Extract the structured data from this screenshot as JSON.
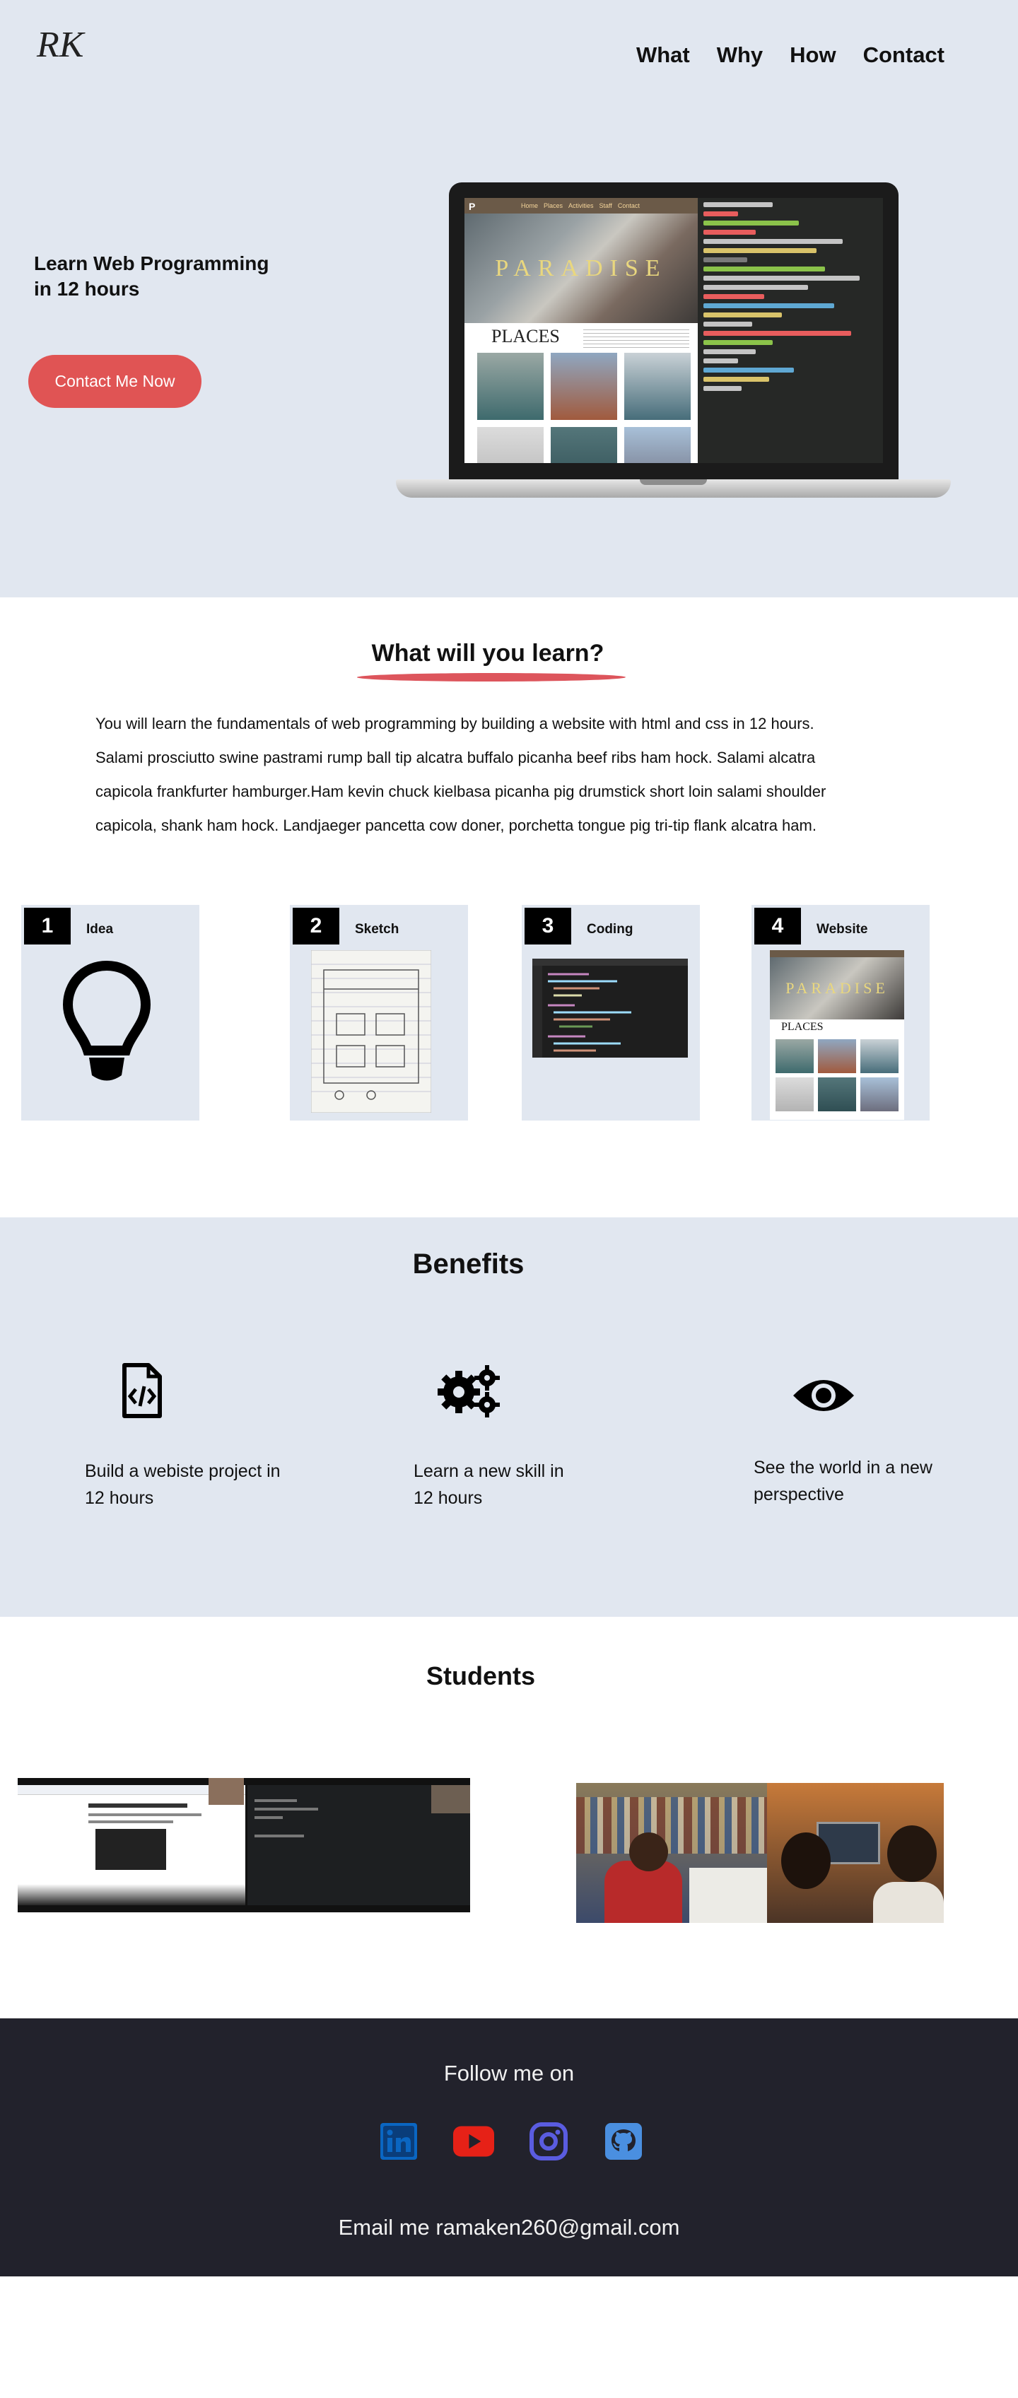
{
  "header": {
    "logo_text": "RK",
    "nav": [
      "What",
      "Why",
      "How",
      "Contact"
    ]
  },
  "hero": {
    "title_line1": "Learn Web Programming",
    "title_line2": "in 12 hours",
    "cta_label": "Contact Me Now",
    "laptop_site": {
      "nav_items": [
        "Home",
        "Places",
        "Activities",
        "Staff",
        "Contact"
      ],
      "banner": "PARADISE",
      "section": "PLACES"
    }
  },
  "learn": {
    "title": "What will you learn?",
    "paragraph_lines": [
      "You will learn the fundamentals of web programming by building a website with html and css in 12 hours.",
      "Salami prosciutto swine pastrami rump ball tip alcatra buffalo picanha beef ribs ham hock. Salami alcatra",
      "capicola frankfurter hamburger.Ham kevin chuck kielbasa picanha pig drumstick short loin salami shoulder",
      "capicola, shank ham hock. Landjaeger pancetta cow doner, porchetta tongue pig tri-tip flank alcatra ham."
    ],
    "steps": [
      {
        "num": "1",
        "label": "Idea"
      },
      {
        "num": "2",
        "label": "Sketch"
      },
      {
        "num": "3",
        "label": "Coding"
      },
      {
        "num": "4",
        "label": "Website"
      }
    ],
    "website_step": {
      "banner": "PARADISE",
      "section": "PLACES"
    }
  },
  "benefits": {
    "title": "Benefits",
    "items": [
      {
        "icon": "code-file-icon",
        "line1": "Build a webiste project in",
        "line2": "12 hours"
      },
      {
        "icon": "gears-icon",
        "line1": "Learn a new skill in",
        "line2": "12 hours"
      },
      {
        "icon": "eye-icon",
        "line1": "See the world in a new",
        "line2": "perspective"
      }
    ]
  },
  "students": {
    "title": "Students"
  },
  "footer": {
    "follow": "Follow me on",
    "socials": [
      "linkedin-icon",
      "youtube-icon",
      "instagram-icon",
      "github-icon"
    ],
    "email": "Email me ramaken260@gmail.com",
    "colors": {
      "linkedin": "#0a66c2",
      "youtube": "#e62117",
      "instagram": "#5a5ce0",
      "github": "#4a8fe0"
    }
  },
  "colors": {
    "hero_bg": "#e1e7f0",
    "accent": "#e05454",
    "footer_bg": "#22222c"
  }
}
